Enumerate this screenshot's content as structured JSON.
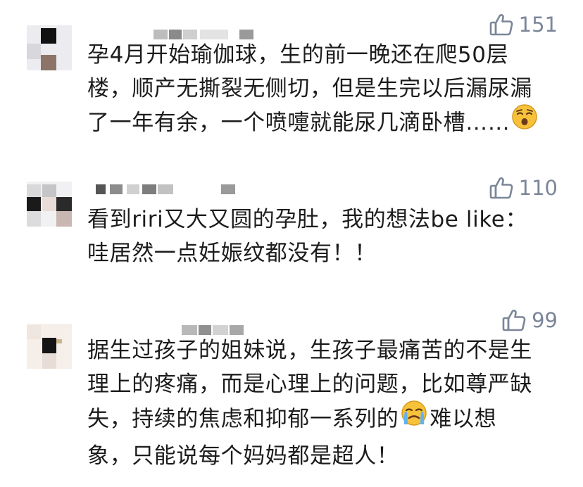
{
  "comments": [
    {
      "likes": "151",
      "lines": [
        "孕4月开始瑜伽球，生的前一晚还在爬50层",
        "楼，顺产无撕裂无侧切，但是生完以后漏尿漏",
        "了一年有余，一个喷嚏就能尿几滴卧槽……"
      ],
      "emoji": "astonished-face-emoji"
    },
    {
      "likes": "110",
      "lines": [
        "看到riri又大又圆的孕肚，我的想法be like：",
        "哇居然一点妊娠纹都没有！！"
      ]
    },
    {
      "likes": "99",
      "lines": [
        "据生过孩子的姐妹说，生孩子最痛苦的不是生",
        "理上的疼痛，而是心理上的问题，比如尊严缺",
        "失，持续的焦虑和抑郁一系列的",
        "难以想",
        "象，只能说每个妈妈都是超人！"
      ],
      "emoji": "loudly-crying-face-emoji"
    }
  ],
  "icons": {
    "like": "thumbs-up-outline-icon"
  },
  "colors": {
    "like_text": "#7b8699",
    "comment_text": "#1c1c1c",
    "background": "#ffffff"
  }
}
